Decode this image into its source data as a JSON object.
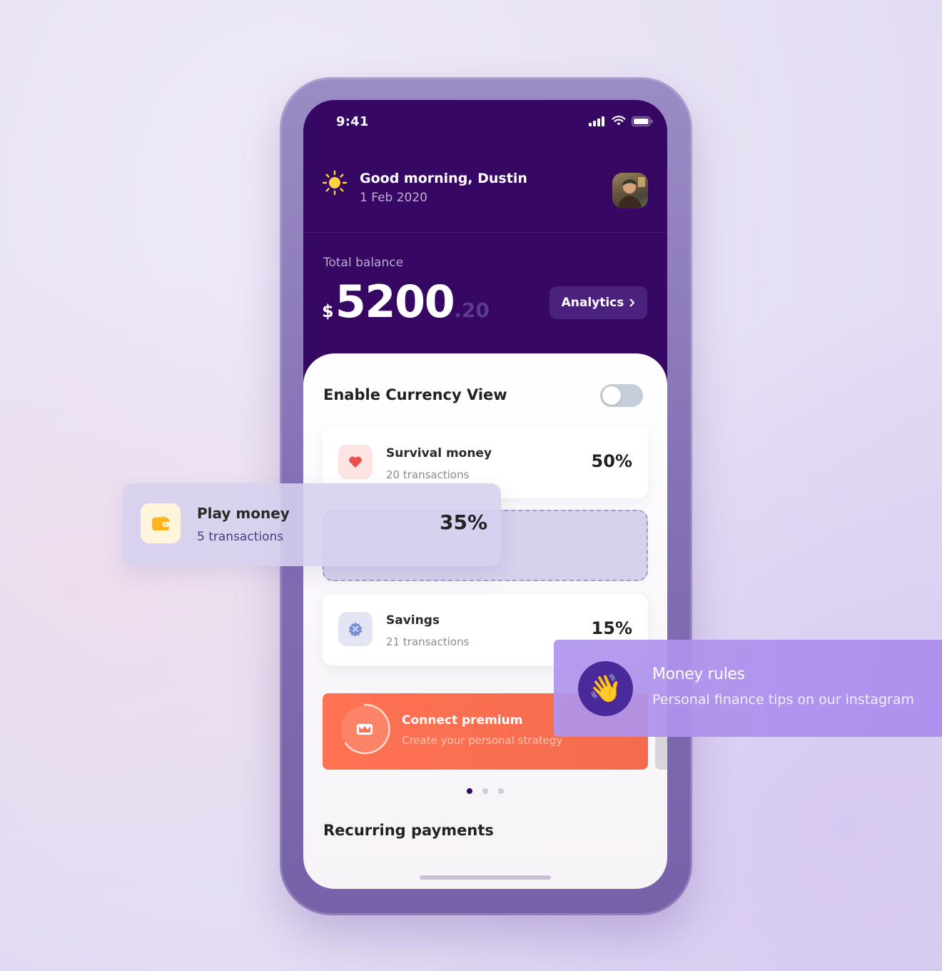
{
  "status_bar": {
    "time": "9:41"
  },
  "greeting": {
    "title": "Good morning, Dustin",
    "date": "1 Feb 2020"
  },
  "balance": {
    "label": "Total balance",
    "currency": "$",
    "amount": "5200",
    "cents": ".20"
  },
  "analytics_button": {
    "label": "Analytics"
  },
  "currency_view": {
    "label": "Enable Currency View",
    "enabled": false
  },
  "categories": [
    {
      "name": "Survival money",
      "transactions": "20 transactions",
      "percent": "50%",
      "icon": "heart-icon"
    },
    {
      "name": "Play money",
      "transactions": "5 transactions",
      "percent": "35%",
      "icon": "wallet-icon"
    },
    {
      "name": "Savings",
      "transactions": "21 transactions",
      "percent": "15%",
      "icon": "gear-badge-icon"
    }
  ],
  "premium": {
    "title": "Connect premium",
    "subtitle": "Create your personal strategy"
  },
  "carousel": {
    "active_index": 0,
    "count": 3
  },
  "recurring": {
    "title": "Recurring payments"
  },
  "tip": {
    "title": "Money rules",
    "subtitle": "Personal finance tips on our instagram",
    "emoji": "👋"
  },
  "colors": {
    "header_bg": "#370764",
    "accent_orange": "#ff7252",
    "tip_bg": "#b094ec"
  }
}
